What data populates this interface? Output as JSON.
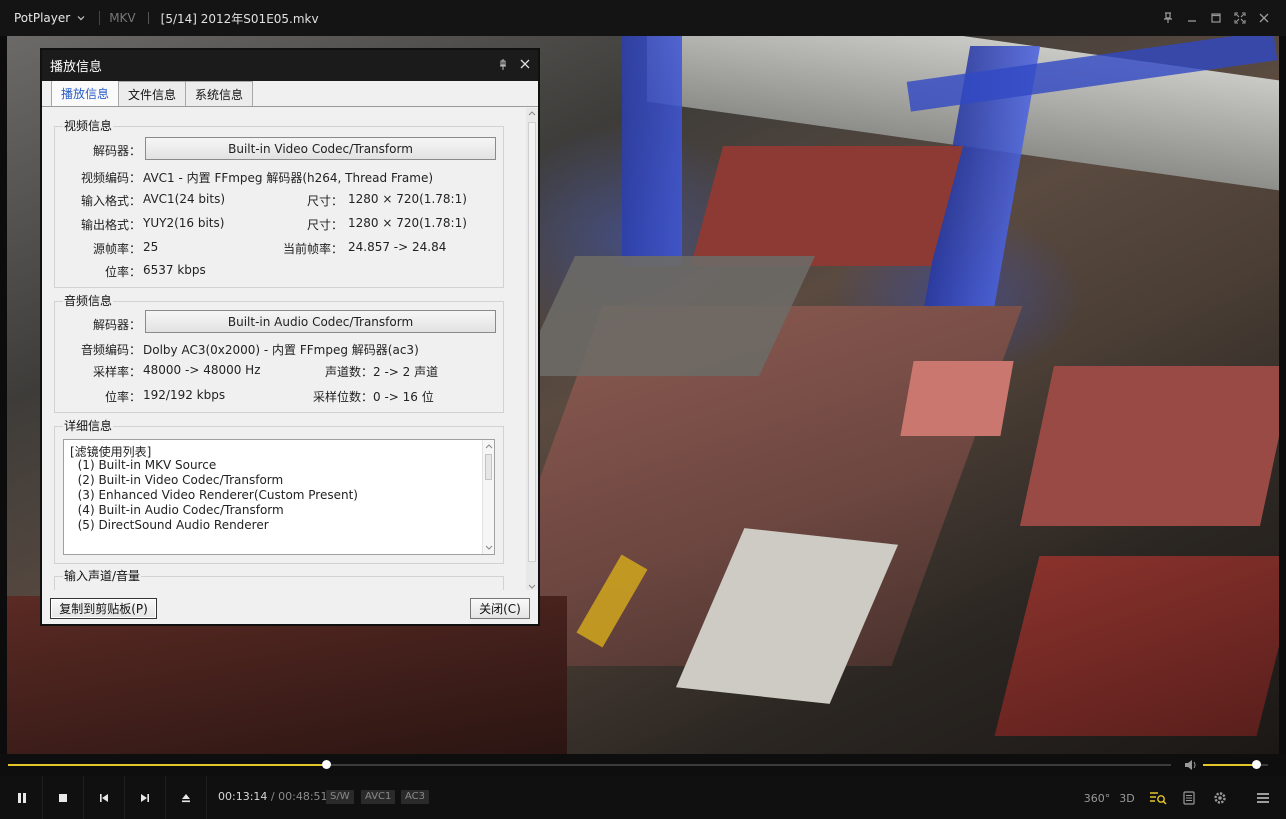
{
  "titlebar": {
    "app_name": "PotPlayer",
    "format": "MKV",
    "title": "[5/14] 2012年S01E05.mkv"
  },
  "dialog": {
    "title": "播放信息",
    "tabs": [
      "播放信息",
      "文件信息",
      "系统信息"
    ],
    "active_tab": 0,
    "video": {
      "group_title": "视频信息",
      "decoder_label": "解码器：",
      "decoder_value": "Built-in Video Codec/Transform",
      "codec_label": "视频编码：",
      "codec_value": "AVC1 - 内置 FFmpeg 解码器(h264, Thread Frame)",
      "input_label": "输入格式：",
      "input_value": "AVC1(24 bits)",
      "input_size_label": "尺寸：",
      "input_size_value": "1280 × 720(1.78:1)",
      "output_label": "输出格式：",
      "output_value": "YUY2(16 bits)",
      "output_size_label": "尺寸：",
      "output_size_value": "1280 × 720(1.78:1)",
      "fps_label": "源帧率：",
      "fps_value": "25",
      "cur_fps_label": "当前帧率：",
      "cur_fps_value": "24.857 -> 24.84",
      "bitrate_label": "位率：",
      "bitrate_value": "6537 kbps"
    },
    "audio": {
      "group_title": "音频信息",
      "decoder_label": "解码器：",
      "decoder_value": "Built-in Audio Codec/Transform",
      "codec_label": "音频编码：",
      "codec_value": "Dolby AC3(0x2000) - 内置 FFmpeg 解码器(ac3)",
      "samplerate_label": "采样率：",
      "samplerate_value": "48000 -> 48000 Hz",
      "channels_label": "声道数：",
      "channels_value": "2 -> 2 声道",
      "bitrate_label": "位率：",
      "bitrate_value": "192/192 kbps",
      "bits_label": "采样位数：",
      "bits_value": "0 -> 16 位"
    },
    "detail": {
      "group_title": "详细信息",
      "lines": [
        "[滤镜使用列表]",
        "  (1) Built-in MKV Source",
        "  (2) Built-in Video Codec/Transform",
        "  (3) Enhanced Video Renderer(Custom Present)",
        "  (4) Built-in Audio Codec/Transform",
        "  (5) DirectSound Audio Renderer"
      ]
    },
    "input_channel": {
      "group_title": "输入声道/音量"
    },
    "copy_button": "复制到剪贴板(P)",
    "close_button": "关闭(C)"
  },
  "player": {
    "seek_fraction": 0.2736,
    "volume_fraction": 0.82,
    "time_current": "00:13:14",
    "time_separator": "/",
    "time_total": "00:48:51",
    "badges": [
      "S/W",
      "AVC1",
      "AC3"
    ],
    "right_icons": [
      "360°",
      "3D"
    ]
  },
  "colors": {
    "accent": "#e3c62a",
    "titlebar": "#141414",
    "dialog_bg": "#f0f0f0",
    "active_tab": "#2a5cc9"
  }
}
